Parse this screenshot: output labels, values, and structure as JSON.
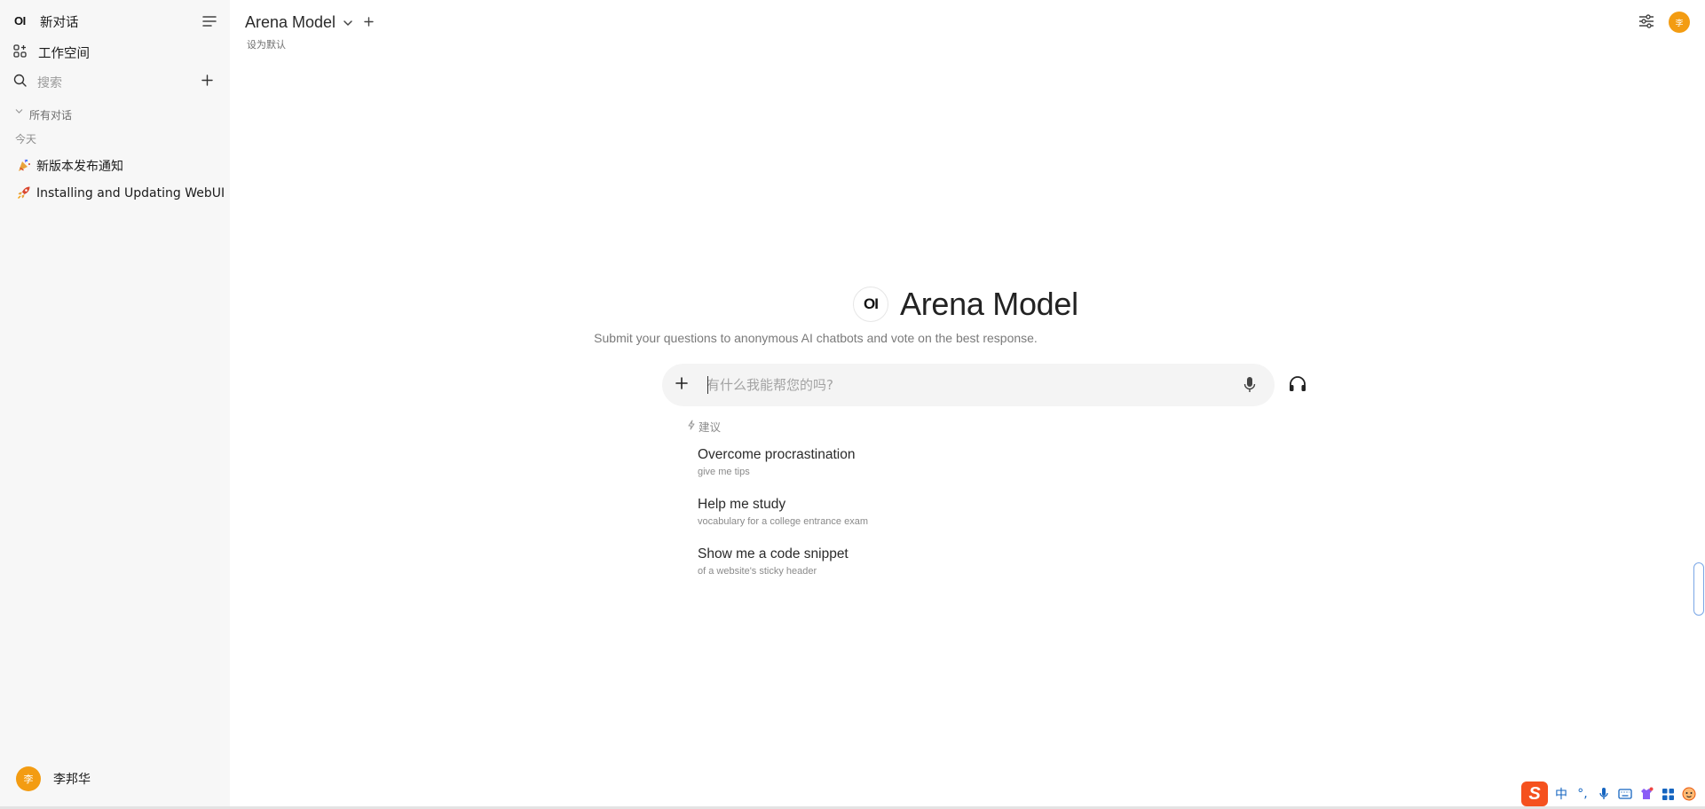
{
  "sidebar": {
    "logo_text": "OI",
    "new_chat": "新对话",
    "workspace": "工作空间",
    "search_placeholder": "搜索",
    "folder_label": "所有对话",
    "group_today": "今天",
    "chats": [
      {
        "emoji": "party-popper-icon",
        "title": "新版本发布通知"
      },
      {
        "emoji": "rocket-icon",
        "title": "Installing and Updating WebUI"
      }
    ],
    "user": {
      "avatar": "李",
      "name": "李邦华"
    }
  },
  "header": {
    "model_name": "Arena Model",
    "set_default": "设为默认",
    "avatar": "李"
  },
  "hero": {
    "logo_text": "OI",
    "title": "Arena Model",
    "subtitle": "Submit your questions to anonymous AI chatbots and vote on the best response."
  },
  "composer": {
    "placeholder": "有什么我能帮您的吗?"
  },
  "suggestions": {
    "header": "建议",
    "items": [
      {
        "title": "Overcome procrastination",
        "subtitle": "give me tips"
      },
      {
        "title": "Help me study",
        "subtitle": "vocabulary for a college entrance exam"
      },
      {
        "title": "Show me a code snippet",
        "subtitle": "of a website's sticky header"
      }
    ]
  },
  "tray": {
    "ime_logo": "S",
    "lang": "中",
    "punct": "°,"
  },
  "colors": {
    "accent_avatar": "#f39c12",
    "sidebar_bg": "#f7f7f7",
    "composer_bg": "#f4f4f4"
  }
}
